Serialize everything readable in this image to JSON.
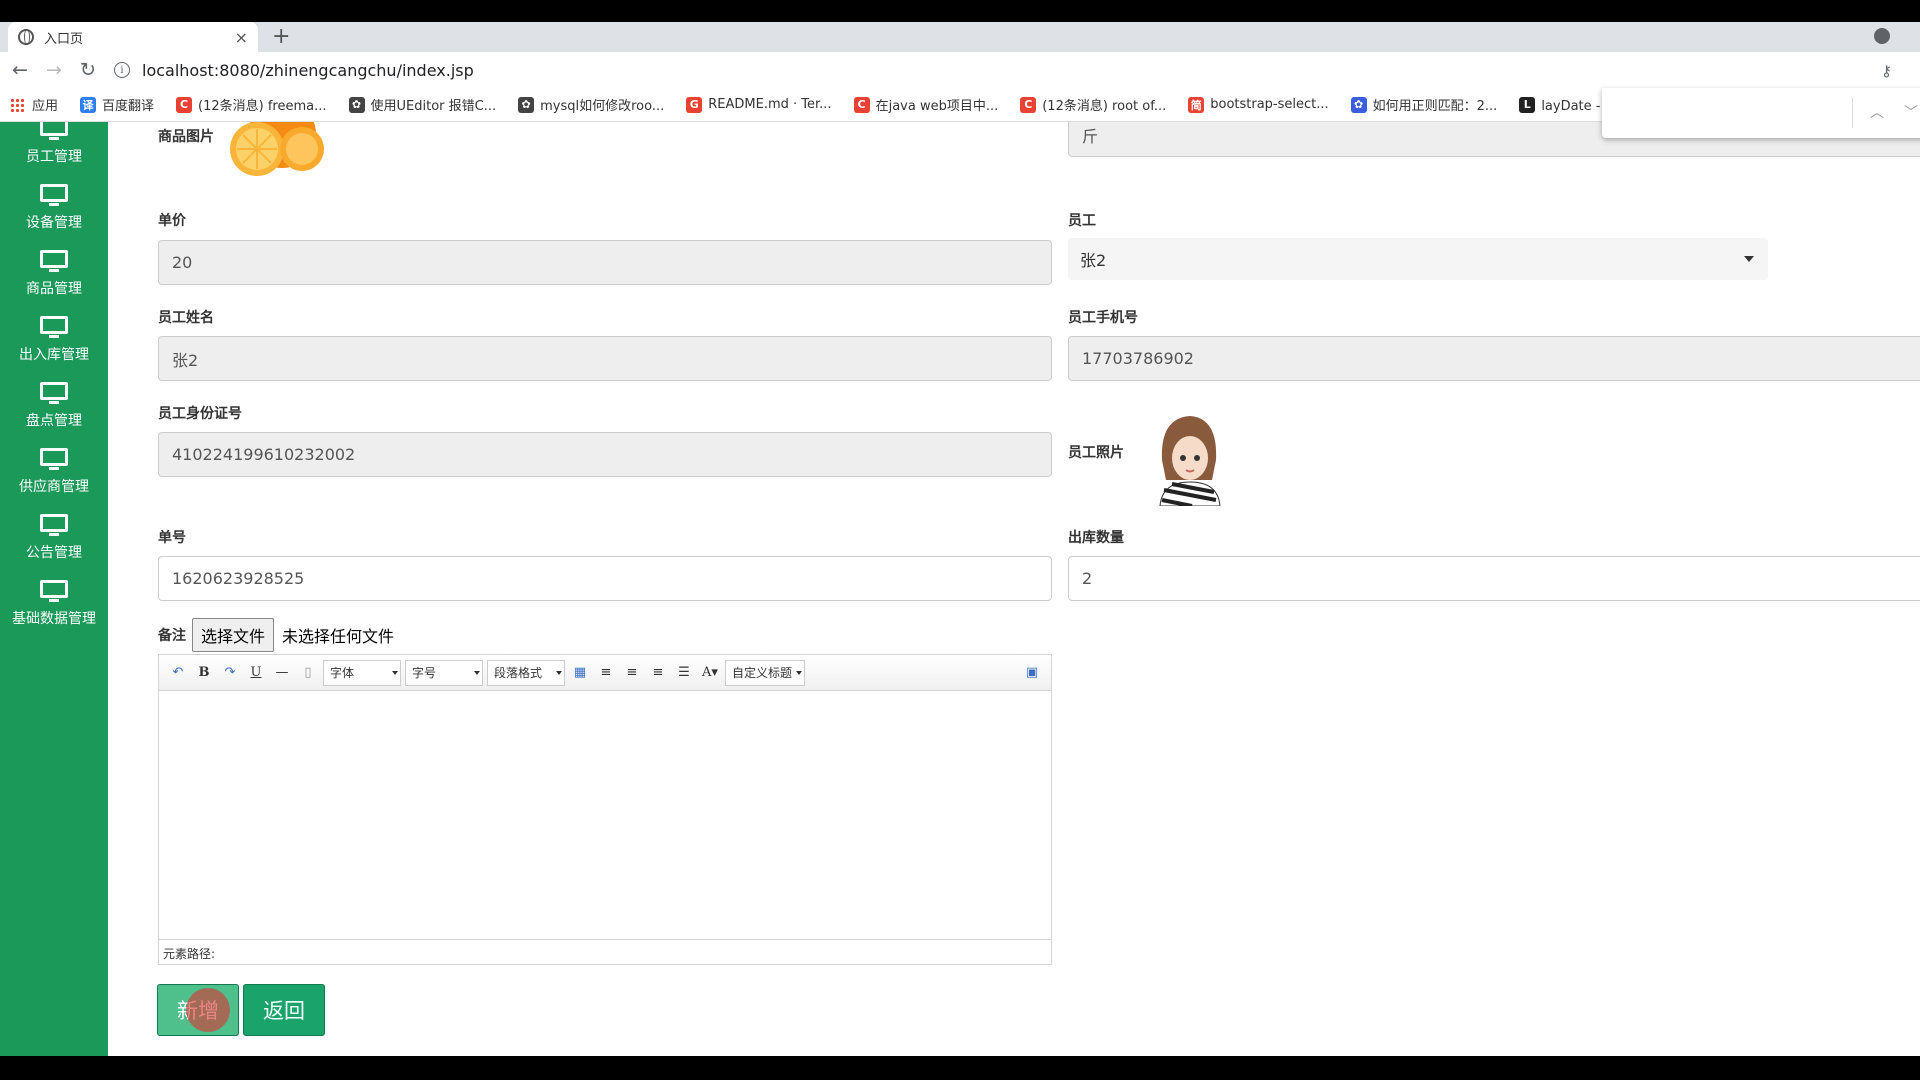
{
  "browser": {
    "tab_title": "入口页",
    "tab_close": "×",
    "new_tab": "+",
    "url": "localhost:8080/zhinengcangchu/index.jsp",
    "bookmarks": [
      {
        "label": "应用"
      },
      {
        "label": "百度翻译",
        "color": "#2d7ff9",
        "glyph": "译"
      },
      {
        "label": "(12条消息) freema...",
        "color": "#e94235",
        "glyph": "C"
      },
      {
        "label": "使用UEditor 报错C...",
        "color": "#444444",
        "glyph": "✿"
      },
      {
        "label": "mysql如何修改roo...",
        "color": "#444444",
        "glyph": "✿"
      },
      {
        "label": "README.md · Ter...",
        "color": "#e94235",
        "glyph": "G"
      },
      {
        "label": "在java web项目中...",
        "color": "#e94235",
        "glyph": "C"
      },
      {
        "label": "(12条消息) root of...",
        "color": "#e94235",
        "glyph": "C"
      },
      {
        "label": "bootstrap-select...",
        "color": "#e94235",
        "glyph": "简"
      },
      {
        "label": "如何用正则匹配：2...",
        "color": "#3b5ee0",
        "glyph": "✿"
      },
      {
        "label": "layDate - JS日期与",
        "color": "#222222",
        "glyph": "L"
      }
    ]
  },
  "sidebar": {
    "items": [
      {
        "label": "员工管理"
      },
      {
        "label": "设备管理"
      },
      {
        "label": "商品管理"
      },
      {
        "label": "出入库管理"
      },
      {
        "label": "盘点管理"
      },
      {
        "label": "供应商管理"
      },
      {
        "label": "公告管理"
      },
      {
        "label": "基础数据管理"
      }
    ]
  },
  "form": {
    "product_image_label": "商品图片",
    "unit_value": "斤",
    "price_label": "单价",
    "price_value": "20",
    "employee_label": "员工",
    "employee_selected": "张2",
    "employee_name_label": "员工姓名",
    "employee_name_value": "张2",
    "employee_phone_label": "员工手机号",
    "employee_phone_value": "17703786902",
    "employee_id_label": "员工身份证号",
    "employee_id_value": "410224199610232002",
    "employee_photo_label": "员工照片",
    "order_no_label": "单号",
    "order_no_value": "1620623928525",
    "out_qty_label": "出库数量",
    "out_qty_value": "2",
    "remark_label": "备注",
    "file_button": "选择文件",
    "file_status": "未选择任何文件"
  },
  "editor": {
    "font_combo": "字体",
    "size_combo": "字号",
    "para_combo": "段落格式",
    "custom_title_combo": "自定义标题",
    "element_path": "元素路径:"
  },
  "buttons": {
    "add": "新增",
    "back": "返回"
  },
  "colors": {
    "sidebar": "#1a9959",
    "button": "#1aa36a"
  }
}
